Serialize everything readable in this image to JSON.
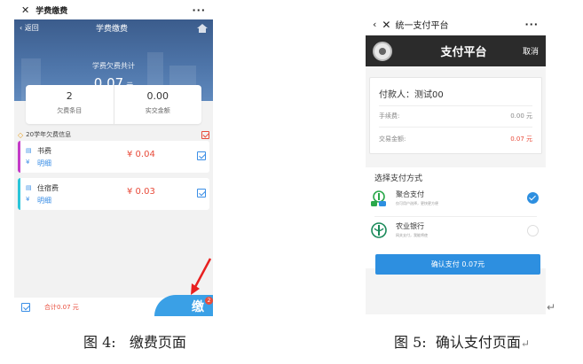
{
  "left_screen": {
    "wechat_title": "学费缴费",
    "back_label": "返回",
    "nav_title": "学费缴费",
    "hero_label": "学费欠费共计",
    "hero_amount": "0.07",
    "hero_unit": "元",
    "stats": [
      {
        "value": "2",
        "label": "欠费条目"
      },
      {
        "value": "0.00",
        "label": "实交金额"
      }
    ],
    "section_title": "20学年欠费信息",
    "fees": [
      {
        "name": "书费",
        "detail": "明细",
        "price": "¥ 0.04",
        "accent": "#c43bc8"
      },
      {
        "name": "住宿费",
        "detail": "明细",
        "price": "¥ 0.03",
        "accent": "#2bc5d8"
      }
    ],
    "total_label": "合计0.07 元",
    "pay_char": "缴",
    "pay_badge": "2"
  },
  "right_screen": {
    "wechat_title": "统一支付平台",
    "platform_title": "支付平台",
    "cancel_label": "取消",
    "payer_label": "付款人：测试00",
    "fee_label": "手续费:",
    "fee_value": "0.00 元",
    "amount_label": "交易金额:",
    "amount_value": "0.07 元",
    "method_title": "选择支付方式",
    "methods": [
      {
        "name": "聚合支付",
        "sub": "仅可用户选择，更快更方便",
        "selected": true
      },
      {
        "name": "农业银行",
        "sub": "网关支付，我能将使",
        "selected": false
      }
    ],
    "confirm_label": "确认支付 0.07元"
  },
  "captions": {
    "left": "图 4:   缴费页面",
    "right": "图 5:  确认支付页面"
  },
  "colors": {
    "primary_blue": "#2d8fe0",
    "price_red": "#e84b3a",
    "hero_blue": "#4d74a8",
    "dark_header": "#2b2b2b"
  }
}
